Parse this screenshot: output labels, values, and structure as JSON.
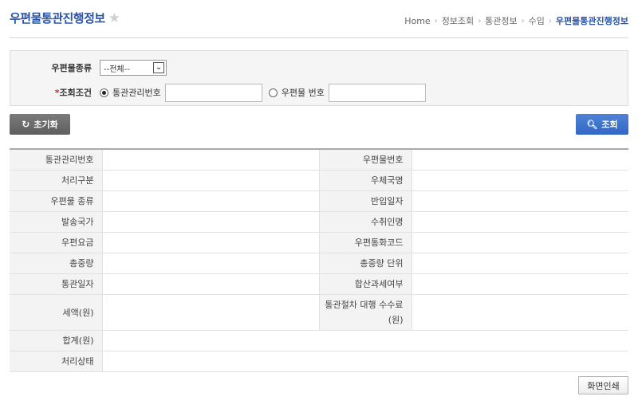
{
  "header": {
    "title": "우편물통관진행정보",
    "breadcrumb": [
      "Home",
      "정보조회",
      "통관정보",
      "수입"
    ],
    "breadcrumb_current": "우편물통관진행정보"
  },
  "search": {
    "mail_type_label": "우편물종류",
    "mail_type_value": "--전체--",
    "condition_required": "*",
    "condition_label": "조회조건",
    "radio1_label": "통관관리번호",
    "radio2_label": "우편물 번호"
  },
  "buttons": {
    "reset": "초기화",
    "search": "조회",
    "print": "화면인쇄"
  },
  "table": {
    "r1": [
      "통관관리번호",
      "우편물번호"
    ],
    "r2": [
      "처리구분",
      "우체국명"
    ],
    "r3": [
      "우편물 종류",
      "반입일자"
    ],
    "r4": [
      "발송국가",
      "수취인명"
    ],
    "r5": [
      "우편요금",
      "우편통화코드"
    ],
    "r6": [
      "총중량",
      "총중량 단위"
    ],
    "r7": [
      "통관일자",
      "합산과세여부"
    ],
    "r8": [
      "세액(원)",
      "통관절차 대행 수수료(원)"
    ],
    "r9": "합계(원)",
    "r10": "처리상태"
  },
  "colors": {
    "accent": "#2a55a6",
    "search_button": "#3a6fcb",
    "reset_button": "#6b6b6b"
  }
}
